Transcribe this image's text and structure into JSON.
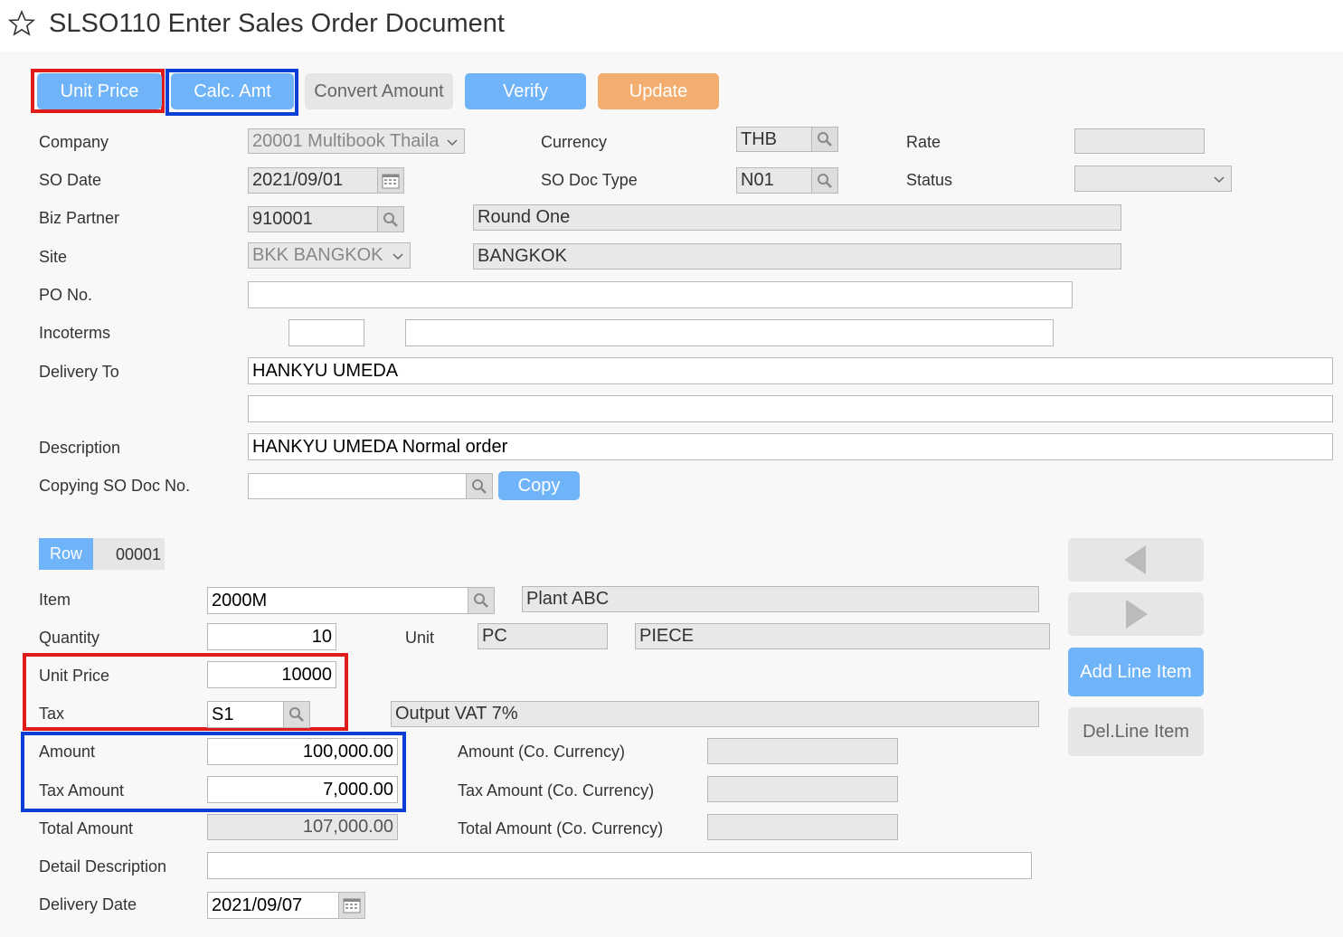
{
  "header": {
    "title": "SLSO110 Enter Sales Order Document"
  },
  "toolbar": {
    "unit_price": "Unit Price",
    "calc_amt": "Calc. Amt",
    "convert_amount": "Convert Amount",
    "verify": "Verify",
    "update": "Update"
  },
  "form": {
    "company_label": "Company",
    "company_value": "20001 Multibook Thaila",
    "currency_label": "Currency",
    "currency_value": "THB",
    "rate_label": "Rate",
    "rate_value": "",
    "so_date_label": "SO Date",
    "so_date_value": "2021/09/01",
    "so_doc_type_label": "SO Doc Type",
    "so_doc_type_value": "N01",
    "status_label": "Status",
    "status_value": "",
    "biz_partner_label": "Biz Partner",
    "biz_partner_value": "910001",
    "biz_partner_name": "Round One",
    "site_label": "Site",
    "site_value": "BKK BANGKOK",
    "site_name": "BANGKOK",
    "po_no_label": "PO No.",
    "po_no_value": "",
    "incoterms_label": "Incoterms",
    "incoterms_code": "",
    "incoterms_desc": "",
    "delivery_to_label": "Delivery To",
    "delivery_to_line1": "HANKYU UMEDA",
    "delivery_to_line2": "",
    "description_label": "Description",
    "description_value": "HANKYU UMEDA Normal order",
    "copying_label": "Copying SO Doc No.",
    "copying_value": "",
    "copy_button": "Copy"
  },
  "line": {
    "row_label": "Row",
    "row_value": "00001",
    "item_label": "Item",
    "item_value": "2000M",
    "item_name": "Plant ABC",
    "quantity_label": "Quantity",
    "quantity_value": "10",
    "unit_label": "Unit",
    "unit_code": "PC",
    "unit_name": "PIECE",
    "unit_price_label": "Unit Price",
    "unit_price_value": "10000",
    "tax_label": "Tax",
    "tax_code": "S1",
    "tax_name": "Output VAT 7%",
    "amount_label": "Amount",
    "amount_value": "100,000.00",
    "amount_co_label": "Amount (Co. Currency)",
    "amount_co_value": "",
    "tax_amount_label": "Tax Amount",
    "tax_amount_value": "7,000.00",
    "tax_amount_co_label": "Tax Amount (Co. Currency)",
    "tax_amount_co_value": "",
    "total_amount_label": "Total Amount",
    "total_amount_value": "107,000.00",
    "total_amount_co_label": "Total Amount (Co. Currency)",
    "total_amount_co_value": "",
    "detail_desc_label": "Detail Description",
    "detail_desc_value": "",
    "delivery_date_label": "Delivery Date",
    "delivery_date_value": "2021/09/07",
    "add_line_item": "Add Line Item",
    "del_line_item": "Del.Line Item"
  },
  "icons": {
    "favorite": "star-icon",
    "search": "magnifier-icon",
    "calendar": "calendar-icon",
    "dropdown": "chevron-down-icon",
    "prev": "triangle-left-icon",
    "next": "triangle-right-icon"
  },
  "colors": {
    "primary_button": "#6fb3f8",
    "update_button": "#f2ad6f",
    "highlight_red": "#e01b1b",
    "highlight_blue": "#0b3fd6"
  }
}
